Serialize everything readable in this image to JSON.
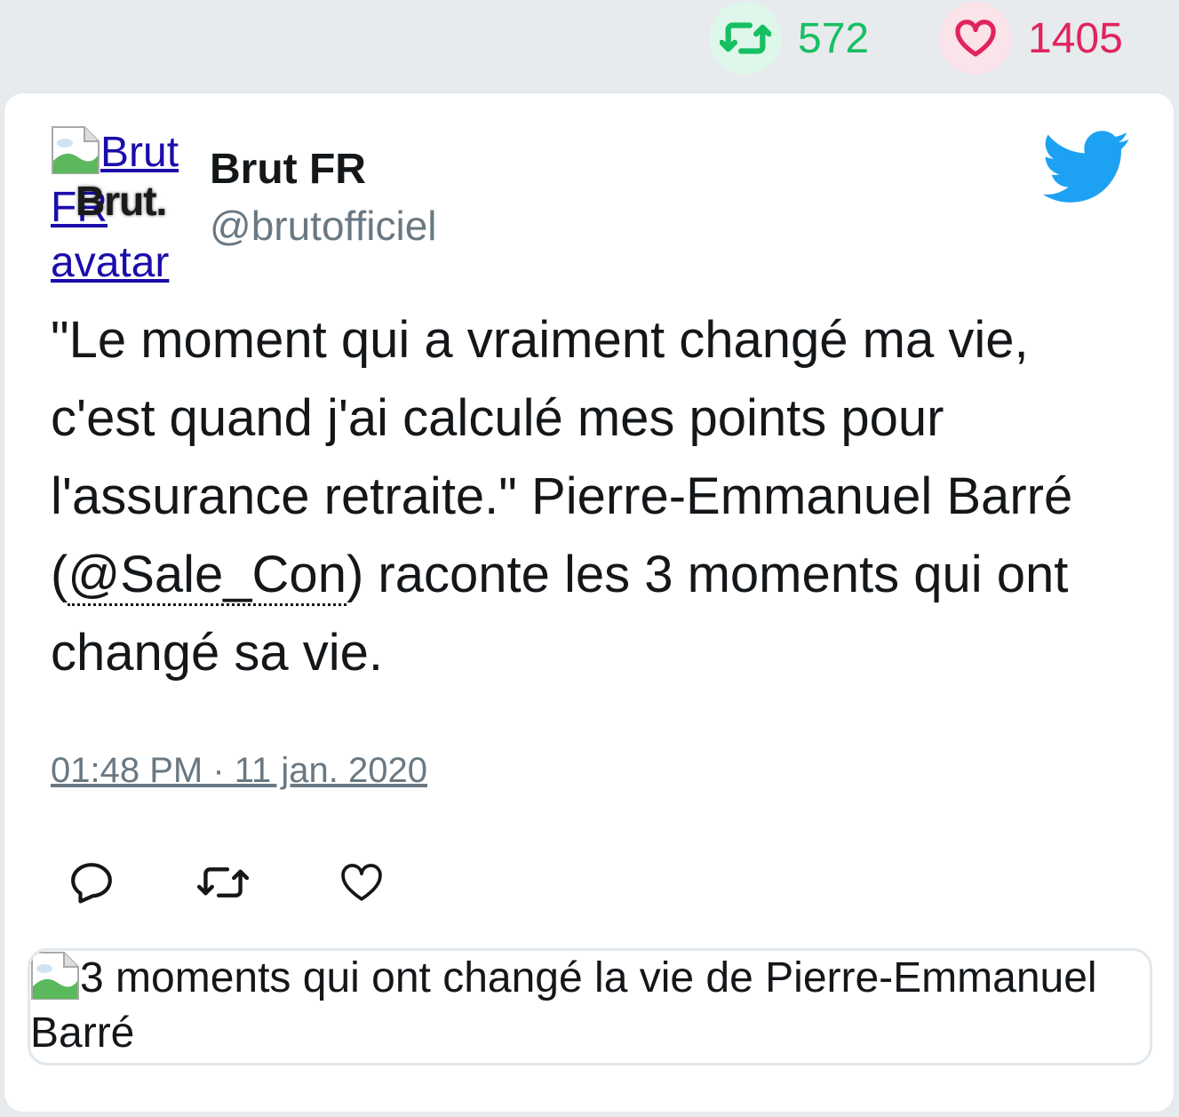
{
  "stats": {
    "retweet_icon": "retweet-icon",
    "retweet_count": "572",
    "like_icon": "heart-icon",
    "like_count": "1405"
  },
  "author": {
    "avatar_alt_line1": "Brut",
    "avatar_alt_line2": "FR",
    "avatar_alt_line3": "avatar",
    "avatar_logo_text": "Brut.",
    "name": "Brut FR",
    "handle": "@brutofficiel"
  },
  "tweet": {
    "text_before": "\"Le moment qui a vraiment changé ma vie, c'est quand j'ai calculé mes points pour l'assurance retraite.\" Pierre-Emmanuel Barré (",
    "mention": "@Sale_Con",
    "text_after": ") raconte les 3 moments qui ont changé sa vie.",
    "timestamp": "01:48 PM · 11 jan. 2020"
  },
  "actions": {
    "reply_icon": "reply-icon",
    "retweet_icon": "retweet-icon",
    "like_icon": "heart-icon"
  },
  "media": {
    "alt_text": "3 moments qui ont changé la vie de Pierre-Emmanuel Barré"
  },
  "colors": {
    "retweet": "#17bf63",
    "like": "#e0245e",
    "twitter_blue": "#1da1f2",
    "muted": "#697882"
  }
}
